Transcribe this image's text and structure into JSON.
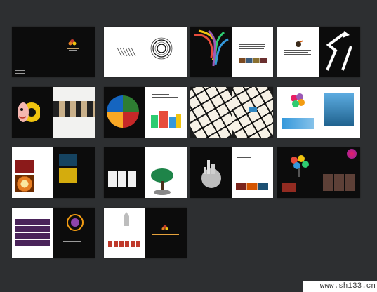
{
  "gallery": {
    "rows": 4,
    "columns": 4,
    "spread_count": 14,
    "background_color": "#2d2f31"
  },
  "spreads": [
    {
      "row": 1,
      "col": 1,
      "left_page": "dark",
      "right_page": "dark",
      "motif": "cover-logo",
      "accent": "#c0392b"
    },
    {
      "row": 1,
      "col": 2,
      "left_page": "white",
      "right_page": "white",
      "motif": "film-strip-and-circle-swirl",
      "accent": "#333333"
    },
    {
      "row": 1,
      "col": 3,
      "left_page": "dark",
      "right_page": "white",
      "motif": "colorful-ribbons",
      "accent": "#e74c3c"
    },
    {
      "row": 1,
      "col": 4,
      "left_page": "white",
      "right_page": "dark",
      "motif": "road-arrow",
      "accent": "#f1c40f"
    },
    {
      "row": 2,
      "col": 1,
      "left_page": "dark",
      "right_page": "light",
      "motif": "film-reel-character",
      "accent": "#f39c12"
    },
    {
      "row": 2,
      "col": 2,
      "left_page": "dark",
      "right_page": "white",
      "motif": "photo-circle-and-buildings",
      "accent": "#2ecc71"
    },
    {
      "row": 2,
      "col": 3,
      "left_page": "light",
      "right_page": "light",
      "motif": "tilted-logo-grid",
      "accent": "#2e86c1"
    },
    {
      "row": 2,
      "col": 4,
      "left_page": "white",
      "right_page": "white",
      "motif": "advert-samples",
      "accent": "#3498db"
    },
    {
      "row": 3,
      "col": 1,
      "left_page": "white",
      "right_page": "dark",
      "motif": "stage-photos",
      "accent": "#e67e22"
    },
    {
      "row": 3,
      "col": 2,
      "left_page": "dark",
      "right_page": "white",
      "motif": "tree-and-camera",
      "accent": "#27ae60"
    },
    {
      "row": 3,
      "col": 3,
      "left_page": "dark",
      "right_page": "white",
      "motif": "city-globe",
      "accent": "#7f8c8d"
    },
    {
      "row": 3,
      "col": 4,
      "left_page": "dark",
      "right_page": "dark",
      "motif": "balloon-tree-and-photos",
      "accent": "#e91e63"
    },
    {
      "row": 4,
      "col": 1,
      "left_page": "white",
      "right_page": "dark",
      "motif": "event-photos-and-logo",
      "accent": "#8e44ad"
    },
    {
      "row": 4,
      "col": 2,
      "left_page": "white",
      "right_page": "dark",
      "motif": "hand-and-contact",
      "accent": "#e74c3c"
    }
  ],
  "watermark": {
    "text": "www.sh133.cn"
  }
}
